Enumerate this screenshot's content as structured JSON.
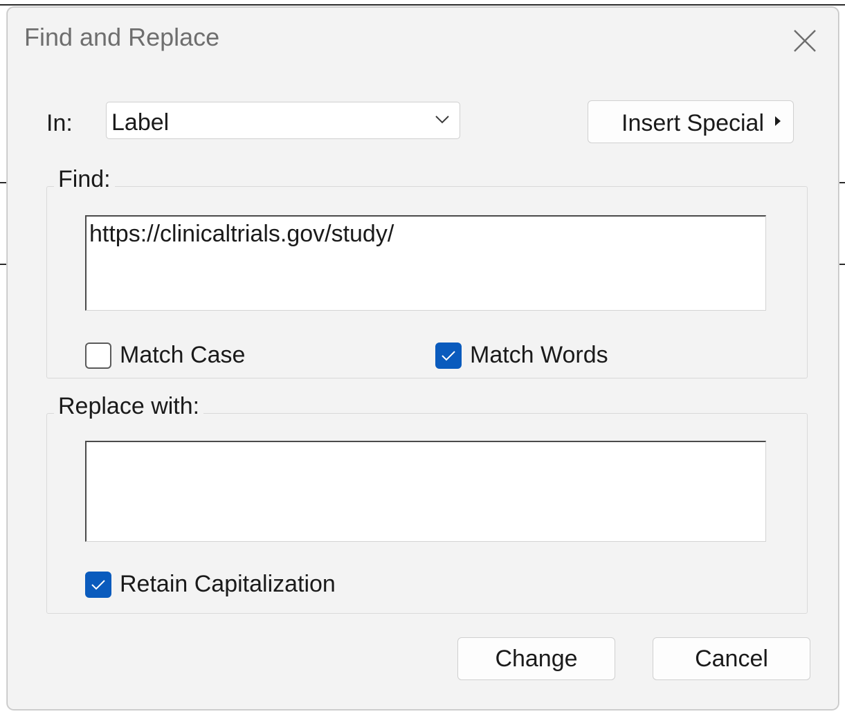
{
  "dialog": {
    "title": "Find and Replace"
  },
  "in_field": {
    "label": "In:",
    "selected": "Label"
  },
  "insert_special": {
    "label": "Insert Special"
  },
  "find": {
    "legend": "Find:",
    "value": "https://clinicaltrials.gov/study/",
    "match_case": {
      "label": "Match Case",
      "checked": false
    },
    "match_words": {
      "label": "Match Words",
      "checked": true
    }
  },
  "replace": {
    "legend": "Replace with:",
    "value": "",
    "retain_capitalization": {
      "label": "Retain Capitalization",
      "checked": true
    }
  },
  "buttons": {
    "change": "Change",
    "cancel": "Cancel"
  },
  "icons": {
    "close": "close-icon",
    "dropdown": "chevron-down-icon",
    "submenu": "caret-right-icon",
    "check": "checkmark-icon"
  },
  "colors": {
    "accent": "#0a5bbd",
    "dialog_bg": "#f3f3f3"
  }
}
